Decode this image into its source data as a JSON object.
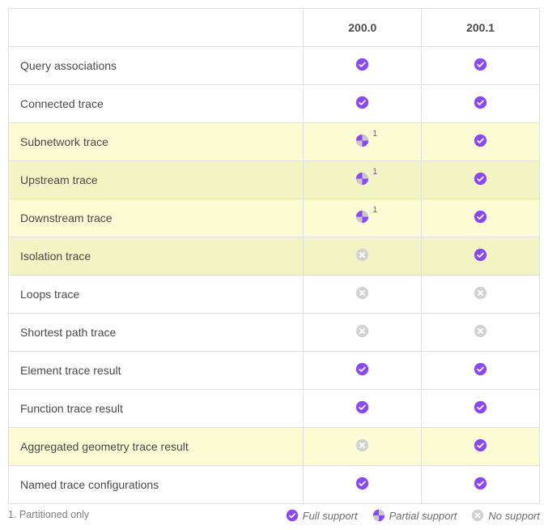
{
  "columns": [
    "",
    "200.0",
    "200.1"
  ],
  "rows": [
    {
      "label": "Query associations",
      "v200_0": "full",
      "v200_1": "full",
      "hl": false,
      "note0": ""
    },
    {
      "label": "Connected trace",
      "v200_0": "full",
      "v200_1": "full",
      "hl": false,
      "note0": ""
    },
    {
      "label": "Subnetwork trace",
      "v200_0": "partial",
      "v200_1": "full",
      "hl": "a",
      "note0": "1"
    },
    {
      "label": "Upstream trace",
      "v200_0": "partial",
      "v200_1": "full",
      "hl": "b",
      "note0": "1"
    },
    {
      "label": "Downstream trace",
      "v200_0": "partial",
      "v200_1": "full",
      "hl": "a",
      "note0": "1"
    },
    {
      "label": "Isolation trace",
      "v200_0": "none",
      "v200_1": "full",
      "hl": "b",
      "note0": ""
    },
    {
      "label": "Loops trace",
      "v200_0": "none",
      "v200_1": "none",
      "hl": false,
      "note0": ""
    },
    {
      "label": "Shortest path trace",
      "v200_0": "none",
      "v200_1": "none",
      "hl": false,
      "note0": ""
    },
    {
      "label": "Element trace result",
      "v200_0": "full",
      "v200_1": "full",
      "hl": false,
      "note0": ""
    },
    {
      "label": "Function trace result",
      "v200_0": "full",
      "v200_1": "full",
      "hl": false,
      "note0": ""
    },
    {
      "label": "Aggregated geometry trace result",
      "v200_0": "none",
      "v200_1": "full",
      "hl": "a",
      "note0": ""
    },
    {
      "label": "Named trace configurations",
      "v200_0": "full",
      "v200_1": "full",
      "hl": false,
      "note0": ""
    }
  ],
  "footnote": "1. Partitioned only",
  "legend": {
    "full": "Full support",
    "partial": "Partial support",
    "none": "No support"
  },
  "colors": {
    "full": "#8a4af3",
    "partial_fg": "#8a4af3",
    "partial_bg": "#c8c8c8",
    "none": "#d2d2d2"
  }
}
